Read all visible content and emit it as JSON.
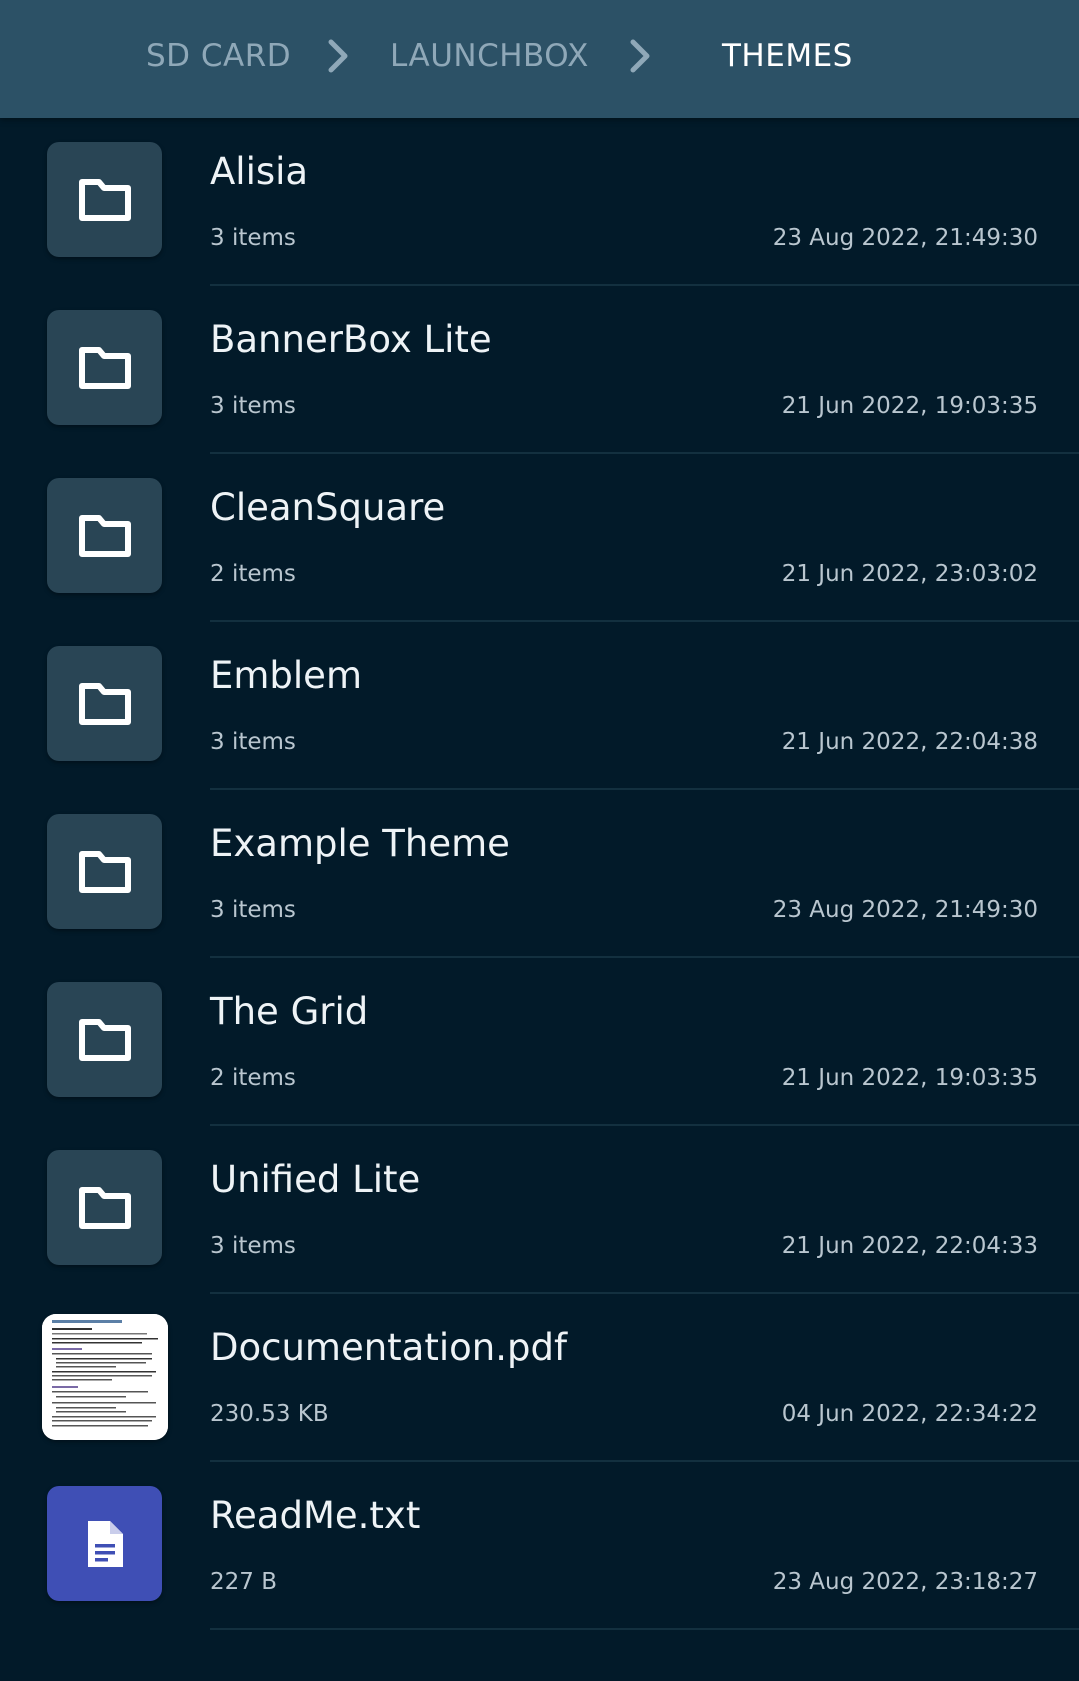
{
  "breadcrumb": {
    "items": [
      "SD CARD",
      "LAUNCHBOX",
      "THEMES"
    ]
  },
  "colors": {
    "background": "#021a29",
    "header": "#2c5166",
    "folder_tile": "#294555",
    "text_file_tile": "#3f4fb5"
  },
  "files": [
    {
      "name": "Alisia",
      "meta": "3 items",
      "date": "23 Aug 2022, 21:49:30",
      "icon": "folder-icon"
    },
    {
      "name": "BannerBox Lite",
      "meta": "3 items",
      "date": "21 Jun 2022, 19:03:35",
      "icon": "folder-icon"
    },
    {
      "name": "CleanSquare",
      "meta": "2 items",
      "date": "21 Jun 2022, 23:03:02",
      "icon": "folder-icon"
    },
    {
      "name": "Emblem",
      "meta": "3 items",
      "date": "21 Jun 2022, 22:04:38",
      "icon": "folder-icon"
    },
    {
      "name": "Example Theme",
      "meta": "3 items",
      "date": "23 Aug 2022, 21:49:30",
      "icon": "folder-icon"
    },
    {
      "name": "The Grid",
      "meta": "2 items",
      "date": "21 Jun 2022, 19:03:35",
      "icon": "folder-icon"
    },
    {
      "name": "Unified Lite",
      "meta": "3 items",
      "date": "21 Jun 2022, 22:04:33",
      "icon": "folder-icon"
    },
    {
      "name": "Documentation.pdf",
      "meta": "230.53 KB",
      "date": "04 Jun 2022, 22:34:22",
      "icon": "pdf-thumbnail"
    },
    {
      "name": "ReadMe.txt",
      "meta": "227 B",
      "date": "23 Aug 2022, 23:18:27",
      "icon": "document-icon"
    }
  ]
}
